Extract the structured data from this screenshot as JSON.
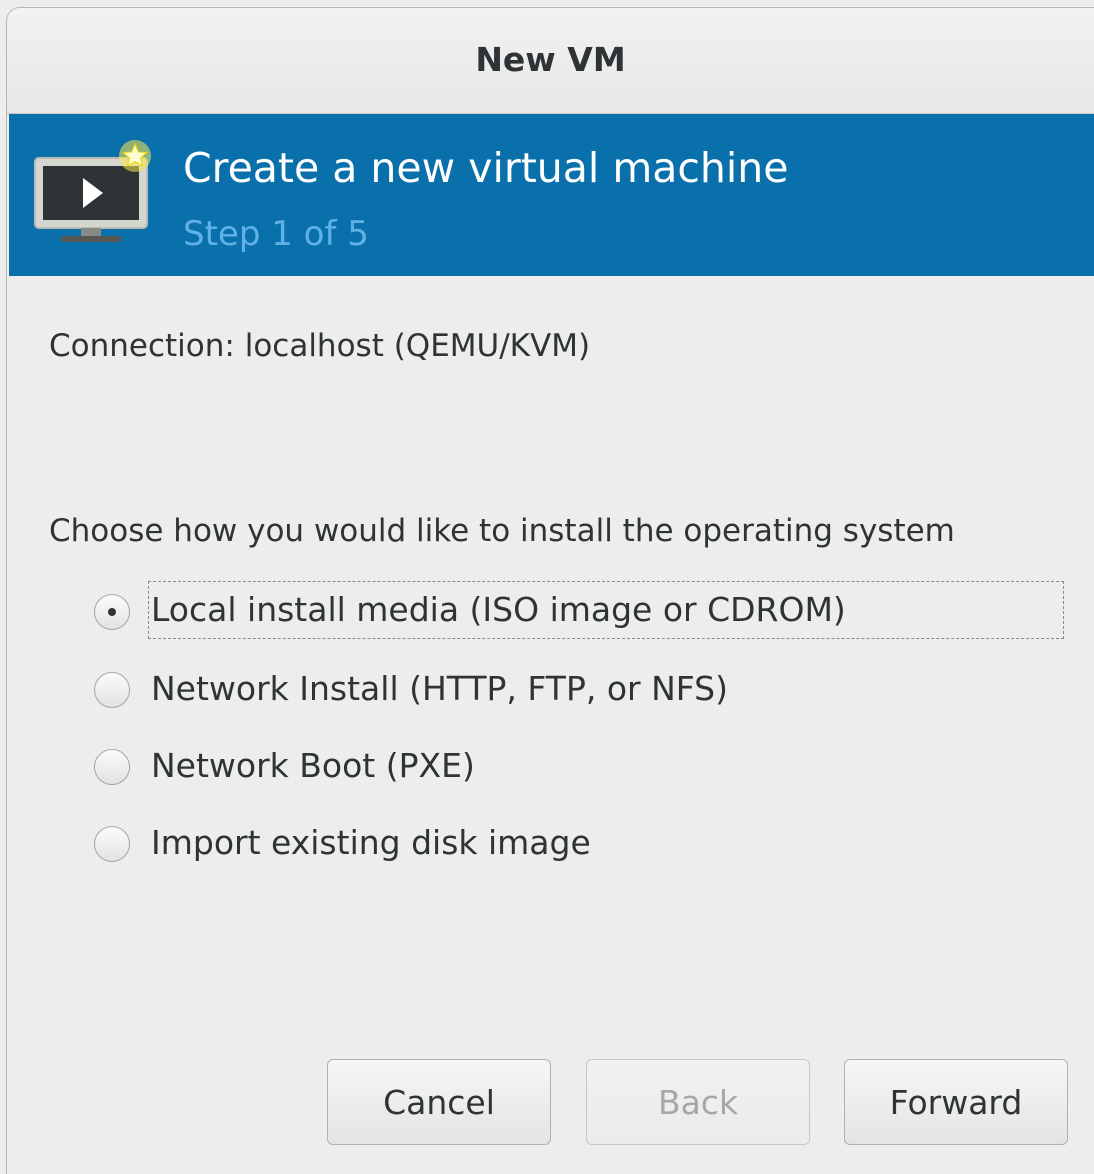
{
  "window": {
    "title": "New VM"
  },
  "banner": {
    "icon": "new-vm-monitor-icon",
    "title": "Create a new virtual machine",
    "step": "Step 1 of 5",
    "background": "#0a70ab",
    "step_color": "#5fb1e6"
  },
  "connection": {
    "text": "Connection: localhost (QEMU/KVM)"
  },
  "install": {
    "prompt": "Choose how you would like to install the operating system",
    "options": [
      {
        "label": "Local install media (ISO image or CDROM)",
        "selected": true
      },
      {
        "label": "Network Install (HTTP, FTP, or NFS)",
        "selected": false
      },
      {
        "label": "Network Boot (PXE)",
        "selected": false
      },
      {
        "label": "Import existing disk image",
        "selected": false
      }
    ]
  },
  "buttons": {
    "cancel": "Cancel",
    "back": "Back",
    "forward": "Forward",
    "back_disabled": true
  }
}
